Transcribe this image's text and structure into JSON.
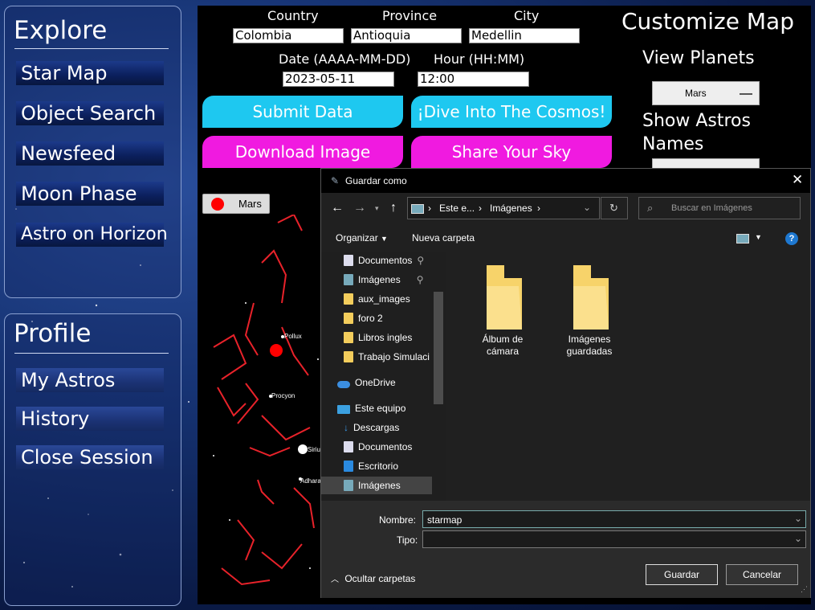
{
  "explore": {
    "title": "Explore",
    "items": [
      "Star Map",
      "Object Search",
      "Newsfeed",
      "Moon Phase",
      "Astro on Horizon"
    ]
  },
  "profile": {
    "title": "Profile",
    "items": [
      "My Astros",
      "History",
      "Close Session"
    ]
  },
  "form": {
    "country_label": "Country",
    "province_label": "Province",
    "city_label": "City",
    "country_value": "Colombia",
    "province_value": "Antioquia",
    "city_value": "Medellin",
    "date_label": "Date (AAAA-MM-DD)",
    "hour_label": "Hour (HH:MM)",
    "date_value": "2023-05-11",
    "hour_value": "12:00"
  },
  "actions": {
    "submit": "Submit Data",
    "dive": "¡Dive Into The Cosmos!",
    "download": "Download Image",
    "share": "Share Your Sky"
  },
  "customize": {
    "title": "Customize Map",
    "view_planets": "View Planets",
    "planet_selected": "Mars",
    "show_names": "Show Astros Names"
  },
  "legend": {
    "planet": "Mars",
    "color": "#ff0000"
  },
  "starmap": {
    "labels": [
      "Pollux",
      "Procyon",
      "Sirius",
      "Adhara"
    ]
  },
  "dialog": {
    "title": "Guardar como",
    "breadcrumb": [
      "Este e...",
      "Imágenes"
    ],
    "search_placeholder": "Buscar en Imágenes",
    "organize": "Organizar",
    "new_folder": "Nueva carpeta",
    "nav_items": [
      "Documentos",
      "Imágenes",
      "aux_images",
      "foro 2",
      "Libros ingles",
      "Trabajo Simulaci",
      "OneDrive",
      "Este equipo",
      "Descargas",
      "Documentos",
      "Escritorio",
      "Imágenes"
    ],
    "folders": [
      "Álbum de cámara",
      "Imágenes guardadas"
    ],
    "name_label": "Nombre:",
    "name_value": "starmap",
    "type_label": "Tipo:",
    "type_value": "",
    "hide_folders": "Ocultar carpetas",
    "save": "Guardar",
    "cancel": "Cancelar"
  }
}
